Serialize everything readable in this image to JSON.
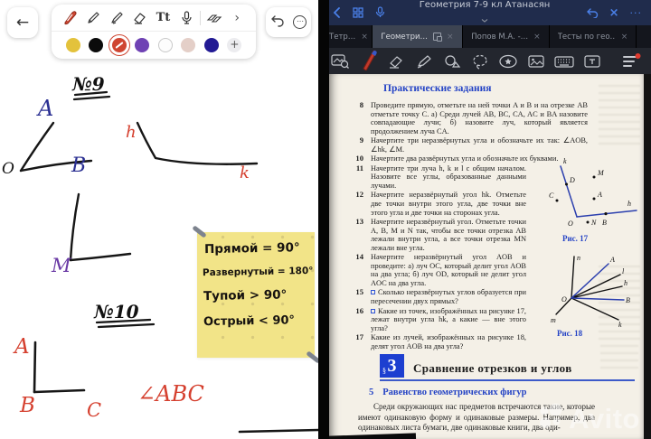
{
  "colors": {
    "accent_blue": "#4a80e8",
    "book_blue": "#2443c5",
    "sticky_yellow": "#f2e488",
    "ink_red": "#d5402f",
    "ink_navy": "#2a2f92",
    "ink_purple": "#6a3aa5",
    "selected_swatch": "#cf4632"
  },
  "left_pane": {
    "toolbar": {
      "back_glyph": "←",
      "text_tool_glyph": "Tt",
      "more_tools_glyph": "›",
      "add_color_glyph": "+",
      "more_dots_glyph": "⋯",
      "swatches": [
        "#e3c23c",
        "#0b0b0b",
        "#cf4632",
        "#6f42b4",
        "#fdfdfd",
        "#e4cfc8",
        "#221a94"
      ]
    },
    "whiteboard": {
      "task1_label": "№9",
      "task2_label": "№10",
      "angle1": {
        "a": "A",
        "o": "O",
        "b": "B"
      },
      "rays": {
        "h": "h",
        "k": "k"
      },
      "angle2": {
        "m": "M"
      },
      "angle3": {
        "a": "A",
        "b": "B",
        "c": "C",
        "name": "∠ABC"
      },
      "sticky_note": {
        "lines": [
          "Прямой = 90°",
          "Развернутый = 180°",
          "Тупой > 90°",
          "Острый < 90°"
        ]
      }
    }
  },
  "right_pane": {
    "topbar": {
      "title": "Геометрия 7-9 кл Атанасян",
      "close_glyph": "×",
      "more_glyph": "···"
    },
    "tabs": [
      {
        "label": "а Тетр…",
        "active": false
      },
      {
        "label": "Геометри…",
        "active": true
      },
      {
        "label": "Попов М.А. -…",
        "active": false
      },
      {
        "label": "Тесты по гео…",
        "active": false
      }
    ],
    "tab_close_glyph": "×",
    "doc": {
      "section_header": "Практические задания",
      "problems": [
        {
          "num": "8",
          "text": "Проведите прямую, отметьте на ней точки A и B и на отрезке AB отметьте точку C. а) Среди лучей AB, BC, CA, AC и BA назовите совпадающие лучи; б) назовите луч, который является продолжением луча CA."
        },
        {
          "num": "9",
          "text": "Начертите три неразвёрнутых угла и обозначьте их так: ∠AOB, ∠hk, ∠M."
        },
        {
          "num": "10",
          "text": "Начертите два развёрнутых угла и обозначьте их буквами."
        },
        {
          "num": "11",
          "text": "Начертите три луча h, k и l с общим началом. Назовите все углы, образованные данными лучами."
        },
        {
          "num": "12",
          "text": "Начертите неразвёрнутый угол hk. Отметьте две точки внутри этого угла, две точки вне этого угла и две точки на сторонах угла."
        },
        {
          "num": "13",
          "text": "Начертите неразвёрнутый угол. Отметьте точки A, B, M и N так, чтобы все точки отрезка AB лежали внутри угла, а все точки отрезка MN лежали вне угла."
        },
        {
          "num": "14",
          "text": "Начертите неразвёрнутый угол AOB и проведите: а) луч OC, который делит угол AOB на два угла; б) луч OD, который не делит угол AOC на два угла."
        },
        {
          "num": "15",
          "text": "Сколько неразвёрнутых углов образуется при пересечении двух прямых?"
        },
        {
          "num": "16",
          "text": "Какие из точек, изображённых на рисунке 17, лежат внутри угла hk, а какие — вне этого угла?"
        },
        {
          "num": "17",
          "text": "Какие из лучей, изображённых на рисунке 18, делят угол AOB на два угла?"
        }
      ],
      "fig17": {
        "caption": "Рис. 17",
        "labels": {
          "k": "k",
          "h": "h",
          "o": "O",
          "d": "D",
          "c": "C",
          "m": "M",
          "a": "A",
          "n": "N",
          "b": "B"
        }
      },
      "fig18": {
        "caption": "Рис. 18",
        "labels": {
          "n": "n",
          "a": "A",
          "l": "l",
          "h": "h",
          "b": "B",
          "k": "k",
          "m": "m",
          "o": "O"
        }
      },
      "section3": {
        "mark": "§",
        "num": "3",
        "title": "Сравнение отрезков и углов"
      },
      "subsection": {
        "num": "5",
        "title": "Равенство геометрических фигур"
      },
      "body_text": "Среди окружающих нас предметов встречаются такие, которые имеют одинаковую форму и одинаковые размеры. Например, два одинаковых листа бумаги, две одинаковые книги, два оди-"
    },
    "watermark": "Avito"
  }
}
